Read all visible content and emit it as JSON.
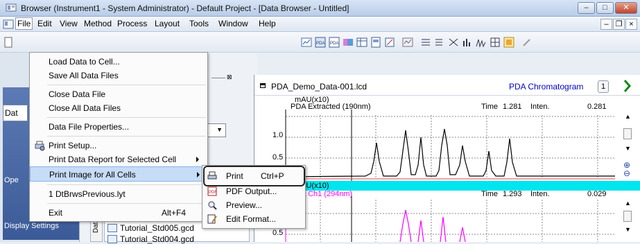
{
  "window": {
    "title": "Browser (Instrument1 - System Administrator) - Default Project - [Data Browser - Untitled]",
    "controls": {
      "minimize": "–",
      "maximize": "□",
      "close": "✕"
    }
  },
  "menubar": {
    "items": [
      "File",
      "Edit",
      "View",
      "Method",
      "Process",
      "Layout",
      "Tools",
      "Window",
      "Help"
    ],
    "mdi": {
      "minimize": "–",
      "restore": "❐",
      "close": "×"
    }
  },
  "left_panel": {
    "data_tab": "Dat",
    "label_ope": "Ope",
    "label_display": "Display Settings"
  },
  "file_menu": {
    "items": [
      {
        "label": "Load Data to Cell..."
      },
      {
        "label": "Save All Data Files"
      },
      {
        "label": "Close Data File"
      },
      {
        "label": "Close All Data Files"
      },
      {
        "label": "Data File Properties..."
      },
      {
        "label": "Print Setup..."
      },
      {
        "label": "Print Data Report for Selected Cell"
      },
      {
        "label": "Print Image for All Cells"
      },
      {
        "label": "1 DtBrwsPrevious.lyt"
      },
      {
        "label": "Exit",
        "shortcut": "Alt+F4"
      }
    ]
  },
  "submenu": {
    "items": [
      {
        "label": "Print",
        "shortcut": "Ctrl+P"
      },
      {
        "label": "PDF Output..."
      },
      {
        "label": "Preview..."
      },
      {
        "label": "Edit Format..."
      }
    ]
  },
  "chart_panel": {
    "filename": "PDA_Demo_Data-001.lcd",
    "kind": "PDA Chromatogram",
    "cell_number": "1",
    "upper": {
      "unit": "mAU(x10)",
      "series": "PDA Extracted (190nm)",
      "time_label": "Time",
      "time_value": "1.281",
      "inten_label": "Inten.",
      "inten_value": "0.281",
      "ticks": [
        "1.0",
        "0.5"
      ]
    },
    "lower": {
      "unit": "mAU(x10)",
      "series": "PDA Ch1 (294nm)",
      "time_label": "Time",
      "time_value": "1.293",
      "inten_label": "Inten.",
      "inten_value": "0.029",
      "ticks": [
        "0.5"
      ]
    }
  },
  "file_list": {
    "tab": "Data",
    "items": [
      "Tutorial_Std005.gcd",
      "Tutorial_Std004.gcd"
    ]
  },
  "colors": {
    "menu_highlight": "#c6dcf7",
    "chart_cyan": "#00e5ee",
    "trace_black": "#000000",
    "trace_magenta": "#ff00ff",
    "accent_blue": "#0000cc"
  }
}
